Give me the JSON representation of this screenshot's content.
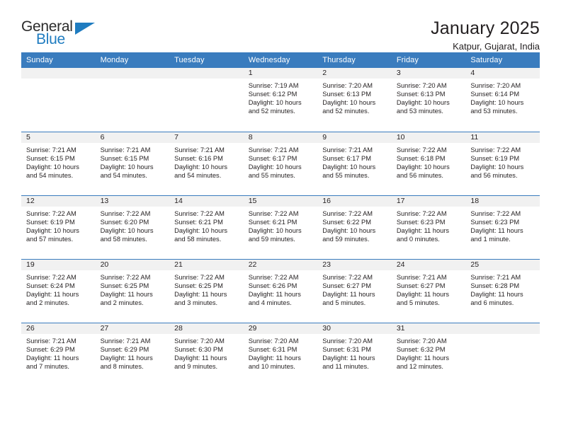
{
  "brand": {
    "name_top": "General",
    "name_bottom": "Blue",
    "triangle_color": "#1f7cc0",
    "accent_color": "#3a7cbe"
  },
  "header": {
    "title": "January 2025",
    "location": "Katpur, Gujarat, India"
  },
  "calendar": {
    "day_headers": [
      "Sunday",
      "Monday",
      "Tuesday",
      "Wednesday",
      "Thursday",
      "Friday",
      "Saturday"
    ],
    "labels": {
      "sunrise": "Sunrise:",
      "sunset": "Sunset:",
      "daylight": "Daylight:"
    },
    "weeks": [
      [
        {
          "day": ""
        },
        {
          "day": ""
        },
        {
          "day": ""
        },
        {
          "day": "1",
          "sunrise": "Sunrise: 7:19 AM",
          "sunset": "Sunset: 6:12 PM",
          "daylight_1": "Daylight: 10 hours",
          "daylight_2": "and 52 minutes."
        },
        {
          "day": "2",
          "sunrise": "Sunrise: 7:20 AM",
          "sunset": "Sunset: 6:13 PM",
          "daylight_1": "Daylight: 10 hours",
          "daylight_2": "and 52 minutes."
        },
        {
          "day": "3",
          "sunrise": "Sunrise: 7:20 AM",
          "sunset": "Sunset: 6:13 PM",
          "daylight_1": "Daylight: 10 hours",
          "daylight_2": "and 53 minutes."
        },
        {
          "day": "4",
          "sunrise": "Sunrise: 7:20 AM",
          "sunset": "Sunset: 6:14 PM",
          "daylight_1": "Daylight: 10 hours",
          "daylight_2": "and 53 minutes."
        }
      ],
      [
        {
          "day": "5",
          "sunrise": "Sunrise: 7:21 AM",
          "sunset": "Sunset: 6:15 PM",
          "daylight_1": "Daylight: 10 hours",
          "daylight_2": "and 54 minutes."
        },
        {
          "day": "6",
          "sunrise": "Sunrise: 7:21 AM",
          "sunset": "Sunset: 6:15 PM",
          "daylight_1": "Daylight: 10 hours",
          "daylight_2": "and 54 minutes."
        },
        {
          "day": "7",
          "sunrise": "Sunrise: 7:21 AM",
          "sunset": "Sunset: 6:16 PM",
          "daylight_1": "Daylight: 10 hours",
          "daylight_2": "and 54 minutes."
        },
        {
          "day": "8",
          "sunrise": "Sunrise: 7:21 AM",
          "sunset": "Sunset: 6:17 PM",
          "daylight_1": "Daylight: 10 hours",
          "daylight_2": "and 55 minutes."
        },
        {
          "day": "9",
          "sunrise": "Sunrise: 7:21 AM",
          "sunset": "Sunset: 6:17 PM",
          "daylight_1": "Daylight: 10 hours",
          "daylight_2": "and 55 minutes."
        },
        {
          "day": "10",
          "sunrise": "Sunrise: 7:22 AM",
          "sunset": "Sunset: 6:18 PM",
          "daylight_1": "Daylight: 10 hours",
          "daylight_2": "and 56 minutes."
        },
        {
          "day": "11",
          "sunrise": "Sunrise: 7:22 AM",
          "sunset": "Sunset: 6:19 PM",
          "daylight_1": "Daylight: 10 hours",
          "daylight_2": "and 56 minutes."
        }
      ],
      [
        {
          "day": "12",
          "sunrise": "Sunrise: 7:22 AM",
          "sunset": "Sunset: 6:19 PM",
          "daylight_1": "Daylight: 10 hours",
          "daylight_2": "and 57 minutes."
        },
        {
          "day": "13",
          "sunrise": "Sunrise: 7:22 AM",
          "sunset": "Sunset: 6:20 PM",
          "daylight_1": "Daylight: 10 hours",
          "daylight_2": "and 58 minutes."
        },
        {
          "day": "14",
          "sunrise": "Sunrise: 7:22 AM",
          "sunset": "Sunset: 6:21 PM",
          "daylight_1": "Daylight: 10 hours",
          "daylight_2": "and 58 minutes."
        },
        {
          "day": "15",
          "sunrise": "Sunrise: 7:22 AM",
          "sunset": "Sunset: 6:21 PM",
          "daylight_1": "Daylight: 10 hours",
          "daylight_2": "and 59 minutes."
        },
        {
          "day": "16",
          "sunrise": "Sunrise: 7:22 AM",
          "sunset": "Sunset: 6:22 PM",
          "daylight_1": "Daylight: 10 hours",
          "daylight_2": "and 59 minutes."
        },
        {
          "day": "17",
          "sunrise": "Sunrise: 7:22 AM",
          "sunset": "Sunset: 6:23 PM",
          "daylight_1": "Daylight: 11 hours",
          "daylight_2": "and 0 minutes."
        },
        {
          "day": "18",
          "sunrise": "Sunrise: 7:22 AM",
          "sunset": "Sunset: 6:23 PM",
          "daylight_1": "Daylight: 11 hours",
          "daylight_2": "and 1 minute."
        }
      ],
      [
        {
          "day": "19",
          "sunrise": "Sunrise: 7:22 AM",
          "sunset": "Sunset: 6:24 PM",
          "daylight_1": "Daylight: 11 hours",
          "daylight_2": "and 2 minutes."
        },
        {
          "day": "20",
          "sunrise": "Sunrise: 7:22 AM",
          "sunset": "Sunset: 6:25 PM",
          "daylight_1": "Daylight: 11 hours",
          "daylight_2": "and 2 minutes."
        },
        {
          "day": "21",
          "sunrise": "Sunrise: 7:22 AM",
          "sunset": "Sunset: 6:25 PM",
          "daylight_1": "Daylight: 11 hours",
          "daylight_2": "and 3 minutes."
        },
        {
          "day": "22",
          "sunrise": "Sunrise: 7:22 AM",
          "sunset": "Sunset: 6:26 PM",
          "daylight_1": "Daylight: 11 hours",
          "daylight_2": "and 4 minutes."
        },
        {
          "day": "23",
          "sunrise": "Sunrise: 7:22 AM",
          "sunset": "Sunset: 6:27 PM",
          "daylight_1": "Daylight: 11 hours",
          "daylight_2": "and 5 minutes."
        },
        {
          "day": "24",
          "sunrise": "Sunrise: 7:21 AM",
          "sunset": "Sunset: 6:27 PM",
          "daylight_1": "Daylight: 11 hours",
          "daylight_2": "and 5 minutes."
        },
        {
          "day": "25",
          "sunrise": "Sunrise: 7:21 AM",
          "sunset": "Sunset: 6:28 PM",
          "daylight_1": "Daylight: 11 hours",
          "daylight_2": "and 6 minutes."
        }
      ],
      [
        {
          "day": "26",
          "sunrise": "Sunrise: 7:21 AM",
          "sunset": "Sunset: 6:29 PM",
          "daylight_1": "Daylight: 11 hours",
          "daylight_2": "and 7 minutes."
        },
        {
          "day": "27",
          "sunrise": "Sunrise: 7:21 AM",
          "sunset": "Sunset: 6:29 PM",
          "daylight_1": "Daylight: 11 hours",
          "daylight_2": "and 8 minutes."
        },
        {
          "day": "28",
          "sunrise": "Sunrise: 7:20 AM",
          "sunset": "Sunset: 6:30 PM",
          "daylight_1": "Daylight: 11 hours",
          "daylight_2": "and 9 minutes."
        },
        {
          "day": "29",
          "sunrise": "Sunrise: 7:20 AM",
          "sunset": "Sunset: 6:31 PM",
          "daylight_1": "Daylight: 11 hours",
          "daylight_2": "and 10 minutes."
        },
        {
          "day": "30",
          "sunrise": "Sunrise: 7:20 AM",
          "sunset": "Sunset: 6:31 PM",
          "daylight_1": "Daylight: 11 hours",
          "daylight_2": "and 11 minutes."
        },
        {
          "day": "31",
          "sunrise": "Sunrise: 7:20 AM",
          "sunset": "Sunset: 6:32 PM",
          "daylight_1": "Daylight: 11 hours",
          "daylight_2": "and 12 minutes."
        },
        {
          "day": ""
        }
      ]
    ]
  }
}
